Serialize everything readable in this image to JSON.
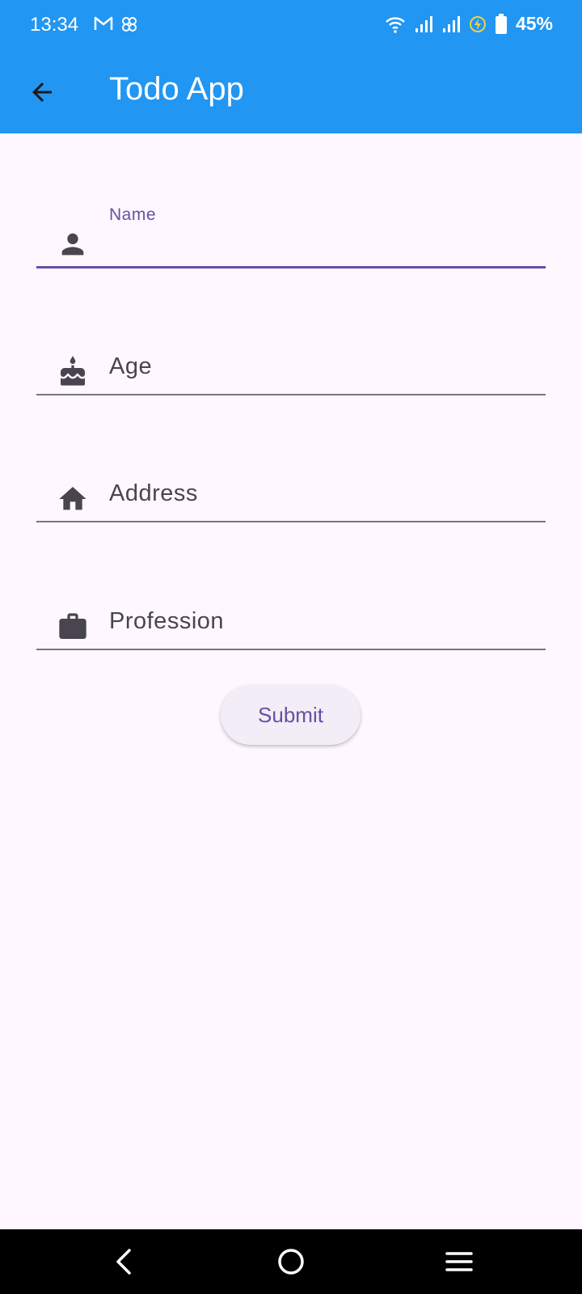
{
  "status_bar": {
    "time": "13:34",
    "battery": "45%",
    "icons": [
      "gmail-icon",
      "pinwheel-icon",
      "wifi-icon",
      "signal-icon",
      "signal-icon",
      "battery-saver-icon",
      "battery-icon"
    ]
  },
  "app_bar": {
    "title": "Todo App",
    "back_icon": "arrow-back-icon",
    "color": "#2196F3"
  },
  "form": {
    "fields": [
      {
        "label": "Name",
        "icon": "person-icon",
        "value": "",
        "focused": true
      },
      {
        "label": "Age",
        "icon": "cake-icon",
        "value": ""
      },
      {
        "label": "Address",
        "icon": "home-icon",
        "value": ""
      },
      {
        "label": "Profession",
        "icon": "work-icon",
        "value": ""
      }
    ],
    "submit_label": "Submit",
    "accent": "#6750A4"
  },
  "nav_bar": {
    "icons": [
      "back-nav-icon",
      "home-nav-icon",
      "menu-nav-icon"
    ]
  }
}
